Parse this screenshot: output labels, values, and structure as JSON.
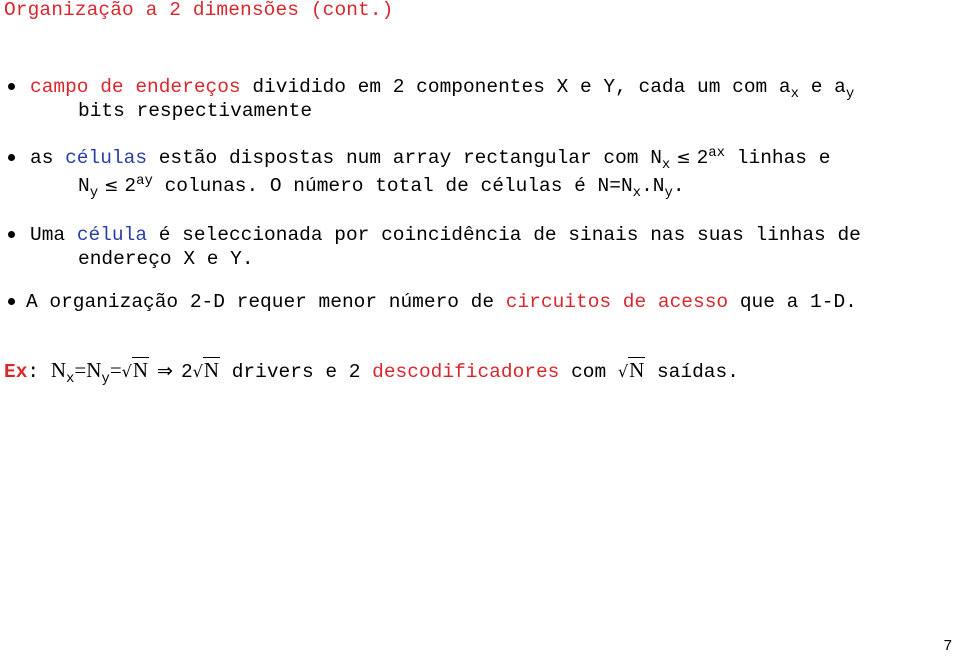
{
  "slide": {
    "title": "Organização a 2 dimensões (cont.)",
    "page_number": "7",
    "colors": {
      "highlight_red": "#d9272e",
      "highlight_blue": "#2a3ea8",
      "text": "#000000"
    }
  },
  "bullets": [
    {
      "highlight": "campo de endereços",
      "text_a": " dividido em 2 componentes X e Y, cada um com a",
      "sub_a": "x",
      "text_b": " e a",
      "sub_b": "y",
      "line2": "bits respectivamente"
    },
    {
      "prefix": "as ",
      "highlight": "células",
      "text_a": " estão dispostas num array rectangular com N",
      "sub_x": "x",
      "le_symbol": "≤",
      "pow_base": "2",
      "sup_ax": "ax",
      "text_b": " linhas e",
      "line2_n": "N",
      "sub_y": "y",
      "pow_base_2": "2",
      "sup_ay": "ay",
      "line2_text": " colunas. O número total de células é N=N",
      "line2_sub_x": "x",
      "line2_mid": ".N",
      "line2_sub_y": "y",
      "line2_end": "."
    },
    {
      "prefix": "Uma ",
      "highlight": "célula",
      "text_a": " é seleccionada por coincidência de sinais nas suas linhas de",
      "line2": "endereço X e Y."
    },
    {
      "prefix": "A organização 2-D requer menor número de ",
      "highlight": "circuitos de acesso",
      "suffix": " que a 1-D."
    }
  ],
  "example": {
    "label": "Ex",
    "colon": ":",
    "n": "N",
    "sub_x": "x",
    "eq1": "=N",
    "sub_y": "y",
    "eq2": "=",
    "sqrt_symbol": "√",
    "radicand": "N",
    "implies": "⇒",
    "two": "2",
    "text_drivers": " drivers e 2 ",
    "highlight": "descodificadores",
    "text_com": " com ",
    "text_end": " saídas."
  }
}
